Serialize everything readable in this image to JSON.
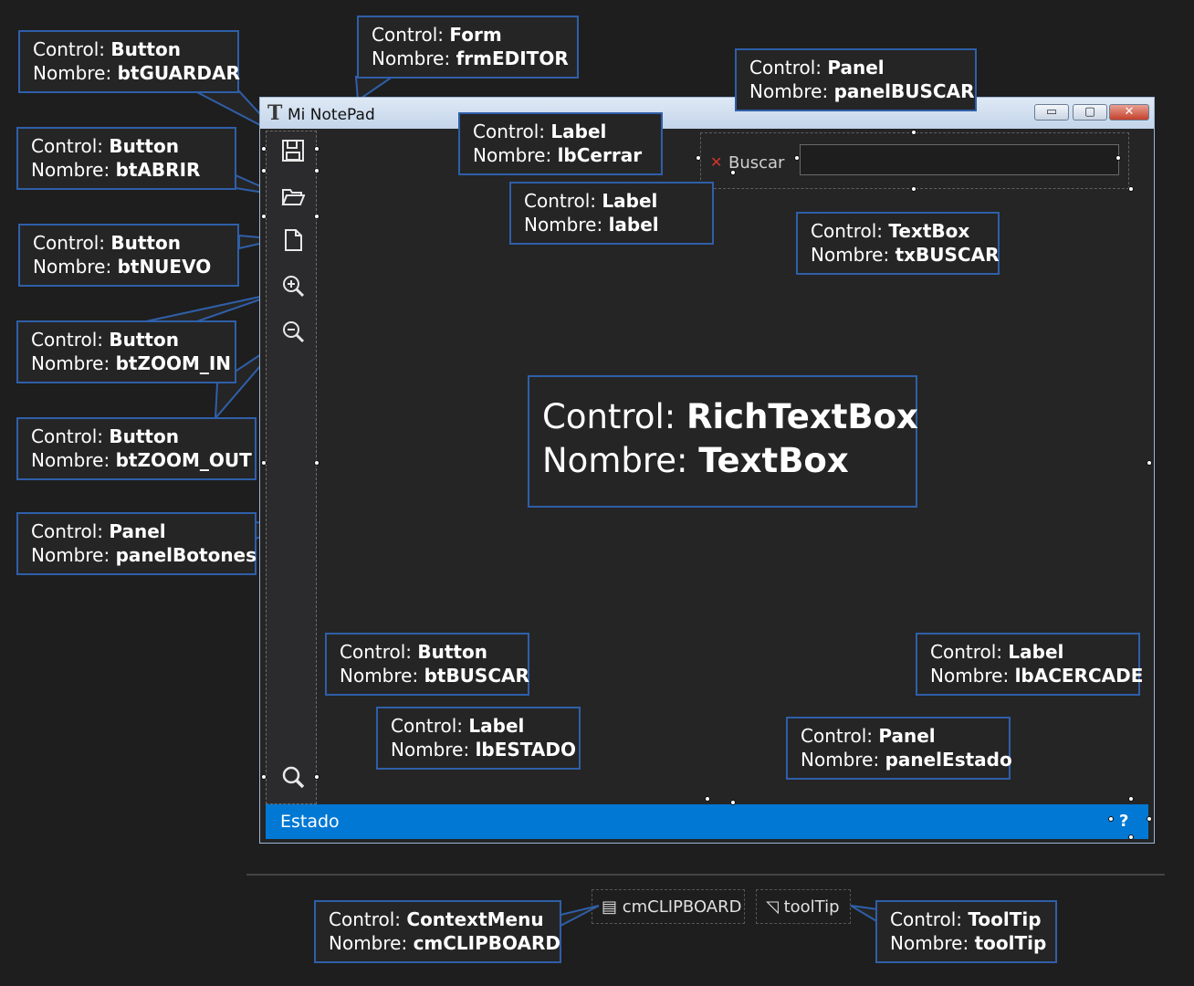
{
  "labels": {
    "control": "Control: ",
    "nombre": "Nombre: "
  },
  "form": {
    "title": "Mi NotePad",
    "icon": "T",
    "window_buttons": {
      "minimize": "▭",
      "maximize": "▢",
      "close": "✕"
    },
    "search": {
      "close_label": "✕",
      "label": "Buscar",
      "textbox_value": ""
    },
    "status": {
      "text": "Estado",
      "about": "?"
    },
    "tool_icons": [
      "save-icon",
      "folder-open-icon",
      "new-file-icon",
      "zoom-in-icon",
      "zoom-out-icon",
      "search-icon"
    ]
  },
  "callouts": {
    "form": {
      "control": "Form",
      "name": "frmEDITOR"
    },
    "btGuardar": {
      "control": "Button",
      "name": "btGUARDAR"
    },
    "btAbrir": {
      "control": "Button",
      "name": "btABRIR"
    },
    "btNuevo": {
      "control": "Button",
      "name": "btNUEVO"
    },
    "btZoomIn": {
      "control": "Button",
      "name": "btZOOM_IN"
    },
    "btZoomOut": {
      "control": "Button",
      "name": "btZOOM_OUT"
    },
    "panelBotones": {
      "control": "Panel",
      "name": "panelBotones"
    },
    "panelBuscar": {
      "control": "Panel",
      "name": "panelBUSCAR"
    },
    "lbCerrar": {
      "control": "Label",
      "name": "lbCerrar"
    },
    "label": {
      "control": "Label",
      "name": "label"
    },
    "txBuscar": {
      "control": "TextBox",
      "name": "txBUSCAR"
    },
    "richTextBox": {
      "control": "RichTextBox",
      "name": "TextBox"
    },
    "btBuscar": {
      "control": "Button",
      "name": "btBUSCAR"
    },
    "lbEstado": {
      "control": "Label",
      "name": "lbESTADO"
    },
    "panelEstado": {
      "control": "Panel",
      "name": "panelEstado"
    },
    "lbAcercade": {
      "control": "Label",
      "name": "lbACERCADE"
    },
    "contextMenu": {
      "control": "ContextMenu",
      "name": "cmCLIPBOARD"
    },
    "toolTip": {
      "control": "ToolTip",
      "name": "toolTip"
    }
  },
  "tray": {
    "context_menu": "cmCLIPBOARD",
    "tool_tip": "toolTip"
  },
  "colors": {
    "accent": "#0078d4",
    "callout_border": "#2f5fa8",
    "background": "#1e1e1e",
    "close_red": "#d0342c"
  }
}
